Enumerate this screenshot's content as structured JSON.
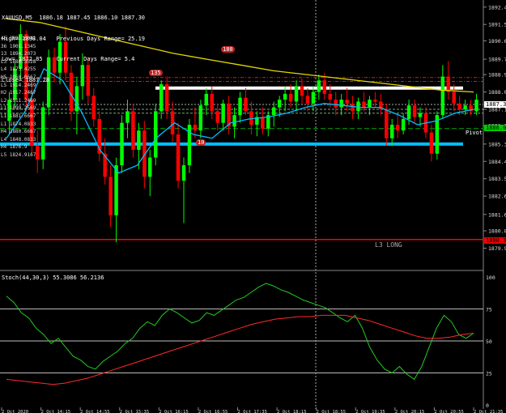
{
  "header": {
    "symbol_tf": "XAUUSD,M5",
    "ohlc": "1886.18 1887.45 1886.10 1887.30",
    "high": "High= 1898.04",
    "low": "Low= 1872.85",
    "close": "Close= 1887.28",
    "prev_days_range": "Previous Days Range= 25.19",
    "current_days_range": "Current Days Range= 5.4"
  },
  "left_levels": [
    "45 1891.6641",
    "36 1901.1345",
    "13 1894.2073",
    "L3 1880.3528",
    "L4 1873.4255",
    "H5 1950.0667",
    "L5 1914.2469",
    "H2 1917.2467",
    "L2 1911.2469",
    "L1 1899.2569",
    "L1 1881.6667",
    "L1 1874.0833",
    "H4 1880.6667",
    "L4 1848.0833",
    "H4 1876.9",
    "L5 1824.9167"
  ],
  "markers": {
    "m180": "180",
    "m135": "135",
    "m10": "10"
  },
  "labels": {
    "pivot": "Pivot",
    "l3long": "L3 LONG",
    "current_price": "1887.30",
    "tag_green": "1886.06",
    "tag_red": "1880.35"
  },
  "stoch_header": "Stoch(44,30,3) 55.3086 56.2136",
  "price_axis": [
    "1892.40",
    "1891.50",
    "1890.65",
    "1889.70",
    "1888.90",
    "1888.00",
    "1887.10",
    "1886.25",
    "1885.30",
    "1884.40",
    "1883.50",
    "1882.60",
    "1881.65",
    "1880.80",
    "1879.90"
  ],
  "stoch_axis": [
    "100",
    "75",
    "50",
    "25",
    "0"
  ],
  "time_axis": [
    "2 Oct 2020",
    "2 Oct 14:15",
    "2 Oct 14:55",
    "2 Oct 15:35",
    "2 Oct 16:15",
    "2 Oct 16:55",
    "2 Oct 17:35",
    "2 Oct 18:15",
    "2 Oct 18:55",
    "2 Oct 19:35",
    "2 Oct 20:15",
    "2 Oct 20:55",
    "2 Oct 21:35"
  ],
  "colors": {
    "bull": "#00ff00",
    "bear": "#ff0000",
    "ma_slow": "#e6d600",
    "ma_fast": "#00bfff",
    "support": "#00bfff",
    "resistance": "#ffffff",
    "l3": "#ff0000",
    "stoch_main": "#22cc22",
    "stoch_signal": "#ff2a2a"
  },
  "chart_data": [
    {
      "type": "candlestick",
      "title": "XAUUSD,M5",
      "ylim": [
        1879.5,
        1892.6
      ],
      "candles": [
        [
          1886.5,
          1888.0,
          1885.8,
          1887.6
        ],
        [
          1887.6,
          1889.5,
          1887.2,
          1889.2
        ],
        [
          1889.2,
          1891.5,
          1888.6,
          1891.0
        ],
        [
          1891.0,
          1891.2,
          1887.0,
          1887.6
        ],
        [
          1887.6,
          1888.6,
          1884.8,
          1885.2
        ],
        [
          1885.2,
          1886.0,
          1883.8,
          1884.5
        ],
        [
          1884.5,
          1887.5,
          1884.0,
          1887.2
        ],
        [
          1887.2,
          1890.2,
          1886.8,
          1889.8
        ],
        [
          1889.8,
          1890.3,
          1888.5,
          1889.0
        ],
        [
          1889.0,
          1891.0,
          1888.4,
          1890.6
        ],
        [
          1890.6,
          1891.4,
          1888.6,
          1889.0
        ],
        [
          1889.0,
          1889.4,
          1886.5,
          1887.0
        ],
        [
          1887.0,
          1888.8,
          1885.8,
          1888.3
        ],
        [
          1888.3,
          1890.0,
          1887.6,
          1889.4
        ],
        [
          1889.4,
          1889.8,
          1887.4,
          1887.8
        ],
        [
          1887.8,
          1888.2,
          1886.2,
          1886.6
        ],
        [
          1886.6,
          1887.0,
          1884.4,
          1884.8
        ],
        [
          1884.8,
          1885.6,
          1883.2,
          1883.6
        ],
        [
          1883.6,
          1884.2,
          1881.0,
          1881.6
        ],
        [
          1881.6,
          1884.6,
          1880.2,
          1884.2
        ],
        [
          1884.2,
          1886.8,
          1883.8,
          1886.4
        ],
        [
          1886.4,
          1887.6,
          1885.6,
          1887.0
        ],
        [
          1887.0,
          1887.4,
          1884.6,
          1885.0
        ],
        [
          1885.0,
          1886.4,
          1884.0,
          1886.0
        ],
        [
          1886.0,
          1886.5,
          1883.0,
          1883.6
        ],
        [
          1883.6,
          1885.0,
          1882.6,
          1884.6
        ],
        [
          1884.6,
          1887.4,
          1884.2,
          1887.0
        ],
        [
          1887.0,
          1888.6,
          1886.6,
          1888.4
        ],
        [
          1888.4,
          1888.8,
          1886.6,
          1887.0
        ],
        [
          1887.0,
          1887.5,
          1885.4,
          1885.8
        ],
        [
          1885.8,
          1886.4,
          1883.0,
          1883.4
        ],
        [
          1883.4,
          1884.6,
          1881.2,
          1884.2
        ],
        [
          1884.2,
          1886.6,
          1883.8,
          1886.3
        ],
        [
          1886.3,
          1887.2,
          1885.6,
          1886.0
        ],
        [
          1886.0,
          1887.6,
          1885.6,
          1887.3
        ],
        [
          1887.3,
          1888.2,
          1886.8,
          1887.9
        ],
        [
          1887.9,
          1888.3,
          1886.6,
          1887.0
        ],
        [
          1887.0,
          1887.4,
          1886.0,
          1886.4
        ],
        [
          1886.4,
          1887.6,
          1886.0,
          1887.4
        ],
        [
          1887.4,
          1887.8,
          1885.8,
          1886.2
        ],
        [
          1886.2,
          1887.2,
          1885.6,
          1886.8
        ],
        [
          1886.8,
          1888.0,
          1886.4,
          1887.7
        ],
        [
          1887.7,
          1888.2,
          1886.8,
          1887.0
        ],
        [
          1887.0,
          1887.5,
          1885.8,
          1886.3
        ],
        [
          1886.3,
          1887.0,
          1885.7,
          1886.7
        ],
        [
          1886.7,
          1887.2,
          1885.8,
          1886.1
        ],
        [
          1886.1,
          1887.0,
          1885.7,
          1886.8
        ],
        [
          1886.8,
          1887.5,
          1886.2,
          1887.2
        ],
        [
          1887.2,
          1887.8,
          1886.7,
          1887.6
        ],
        [
          1887.6,
          1888.3,
          1887.0,
          1887.9
        ],
        [
          1887.9,
          1888.4,
          1887.2,
          1887.5
        ],
        [
          1887.5,
          1888.6,
          1887.0,
          1888.3
        ],
        [
          1888.3,
          1888.7,
          1887.4,
          1887.8
        ],
        [
          1887.8,
          1888.2,
          1887.0,
          1887.4
        ],
        [
          1887.4,
          1888.3,
          1887.0,
          1888.0
        ],
        [
          1888.0,
          1888.9,
          1887.6,
          1888.6
        ],
        [
          1888.6,
          1889.0,
          1887.6,
          1887.9
        ],
        [
          1887.9,
          1888.4,
          1887.2,
          1887.6
        ],
        [
          1887.6,
          1888.0,
          1886.8,
          1887.2
        ],
        [
          1887.2,
          1887.9,
          1886.8,
          1887.6
        ],
        [
          1887.6,
          1888.2,
          1887.0,
          1887.4
        ],
        [
          1887.4,
          1887.8,
          1886.6,
          1887.0
        ],
        [
          1887.0,
          1887.7,
          1886.6,
          1887.5
        ],
        [
          1887.5,
          1888.0,
          1887.0,
          1887.2
        ],
        [
          1887.2,
          1887.8,
          1886.8,
          1887.6
        ],
        [
          1887.6,
          1888.0,
          1887.2,
          1887.5
        ],
        [
          1887.5,
          1887.9,
          1886.8,
          1887.1
        ],
        [
          1887.1,
          1887.4,
          1885.2,
          1885.6
        ],
        [
          1885.6,
          1886.6,
          1885.2,
          1886.3
        ],
        [
          1886.3,
          1886.8,
          1885.6,
          1886.0
        ],
        [
          1886.0,
          1886.9,
          1885.8,
          1886.6
        ],
        [
          1886.6,
          1887.6,
          1886.3,
          1887.3
        ],
        [
          1887.3,
          1887.6,
          1886.4,
          1886.7
        ],
        [
          1886.7,
          1887.2,
          1886.2,
          1886.9
        ],
        [
          1886.9,
          1887.2,
          1885.6,
          1885.9
        ],
        [
          1885.9,
          1886.3,
          1884.4,
          1884.8
        ],
        [
          1884.8,
          1887.0,
          1884.5,
          1886.8
        ],
        [
          1886.8,
          1889.4,
          1886.6,
          1888.8
        ],
        [
          1888.8,
          1889.6,
          1887.6,
          1888.0
        ],
        [
          1888.0,
          1888.4,
          1887.0,
          1887.4
        ],
        [
          1887.4,
          1887.8,
          1886.8,
          1887.1
        ],
        [
          1887.1,
          1887.6,
          1886.8,
          1887.3
        ],
        [
          1887.3,
          1887.6,
          1886.8,
          1887.0
        ],
        [
          1887.0,
          1887.9,
          1886.8,
          1887.6
        ]
      ],
      "ma_slow": [
        1891.8,
        1891.6,
        1891.2,
        1890.8,
        1890.4,
        1890.0,
        1889.7,
        1889.4,
        1889.1,
        1888.9,
        1888.7,
        1888.5,
        1888.3,
        1888.1,
        1888.0
      ],
      "ma_fast": [
        1885.6,
        1887.0,
        1889.2,
        1888.6,
        1887.0,
        1885.0,
        1883.8,
        1884.2,
        1885.6,
        1886.4,
        1885.8,
        1885.6,
        1886.4,
        1886.6,
        1886.7,
        1886.9,
        1887.2,
        1887.4,
        1887.3,
        1887.2,
        1887.2,
        1886.8,
        1886.3,
        1886.5,
        1886.9,
        1887.1
      ],
      "levels": [
        1888.2,
        1885.3,
        1880.35
      ],
      "pivot": 1886.1
    },
    {
      "type": "line",
      "title": "Stoch(44,30,3)",
      "ylim": [
        0,
        100
      ],
      "gridlines": [
        75,
        50,
        25
      ],
      "series": [
        {
          "values": [
            85,
            80,
            72,
            68,
            60,
            55,
            48,
            52,
            45,
            38,
            35,
            30,
            28,
            34,
            38,
            42,
            48,
            52,
            60,
            65,
            62,
            70,
            75,
            72,
            68,
            64,
            66,
            72,
            70,
            74,
            78,
            82,
            84,
            88,
            92,
            95,
            93,
            90,
            88,
            85,
            82,
            80,
            78,
            76,
            72,
            68,
            65,
            70,
            60,
            45,
            35,
            28,
            25,
            30,
            24,
            20,
            30,
            45,
            60,
            70,
            65,
            55,
            52,
            56
          ]
        },
        {
          "values": [
            20,
            19,
            18,
            17,
            16,
            17,
            19,
            21,
            24,
            27,
            30,
            33,
            36,
            39,
            42,
            45,
            48,
            51,
            54,
            57,
            60,
            63,
            65,
            67,
            68,
            69,
            69,
            70,
            70,
            70,
            68,
            66,
            63,
            60,
            57,
            54,
            52,
            52,
            53,
            55,
            56
          ]
        }
      ]
    }
  ]
}
